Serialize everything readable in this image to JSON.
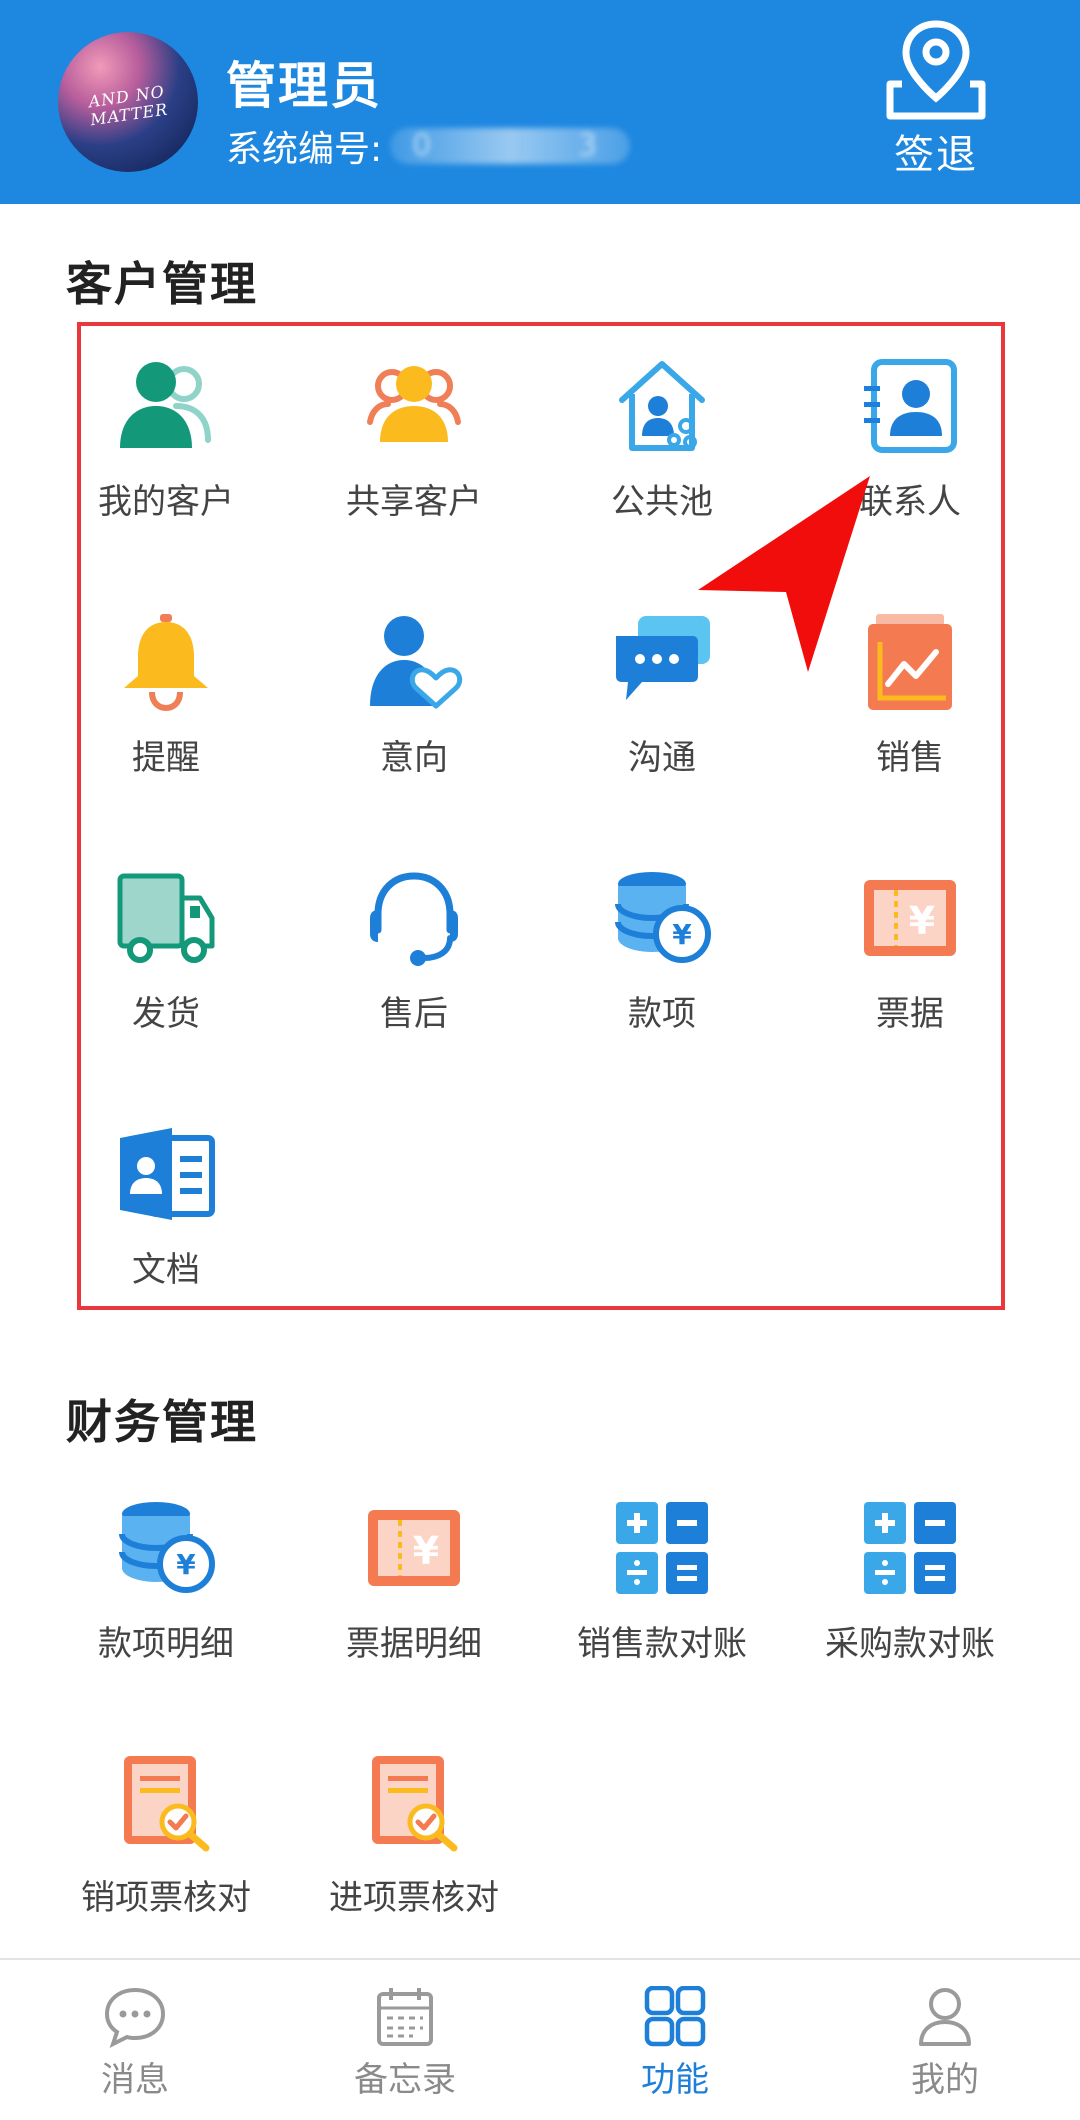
{
  "header": {
    "avatar_text_line1": "AND NO",
    "avatar_text_line2": "MATTER",
    "user_name": "管理员",
    "sysno_label": "系统编号:",
    "sysno_visible_start": "0",
    "sysno_visible_end": "3",
    "logout_label": "签退"
  },
  "customer_section": {
    "title": "客户管理",
    "items": [
      {
        "label": "我的客户",
        "icon": "my-customers-icon"
      },
      {
        "label": "共享客户",
        "icon": "shared-customers-icon"
      },
      {
        "label": "公共池",
        "icon": "public-pool-icon"
      },
      {
        "label": "联系人",
        "icon": "contacts-icon"
      },
      {
        "label": "提醒",
        "icon": "bell-icon"
      },
      {
        "label": "意向",
        "icon": "intention-icon"
      },
      {
        "label": "沟通",
        "icon": "chat-icon"
      },
      {
        "label": "销售",
        "icon": "sales-chart-icon"
      },
      {
        "label": "发货",
        "icon": "truck-icon"
      },
      {
        "label": "售后",
        "icon": "headset-icon"
      },
      {
        "label": "款项",
        "icon": "coins-yen-icon"
      },
      {
        "label": "票据",
        "icon": "ticket-yen-icon"
      },
      {
        "label": "文档",
        "icon": "document-icon"
      }
    ]
  },
  "finance_section": {
    "title": "财务管理",
    "items": [
      {
        "label": "款项明细",
        "icon": "coins-yen-icon"
      },
      {
        "label": "票据明细",
        "icon": "ticket-yen-icon"
      },
      {
        "label": "销售款对账",
        "icon": "calculator-icon"
      },
      {
        "label": "采购款对账",
        "icon": "calculator-icon"
      },
      {
        "label": "销项票核对",
        "icon": "invoice-check-icon"
      },
      {
        "label": "进项票核对",
        "icon": "invoice-check-icon"
      }
    ]
  },
  "bottom_nav": {
    "items": [
      {
        "label": "消息",
        "icon": "message-icon"
      },
      {
        "label": "备忘录",
        "icon": "calendar-icon"
      },
      {
        "label": "功能",
        "icon": "grid-icon",
        "active": true
      },
      {
        "label": "我的",
        "icon": "user-icon"
      }
    ]
  },
  "colors": {
    "header_bg": "#1e88e0",
    "highlight_border": "#e8383d",
    "active_nav": "#1e7fd8"
  }
}
